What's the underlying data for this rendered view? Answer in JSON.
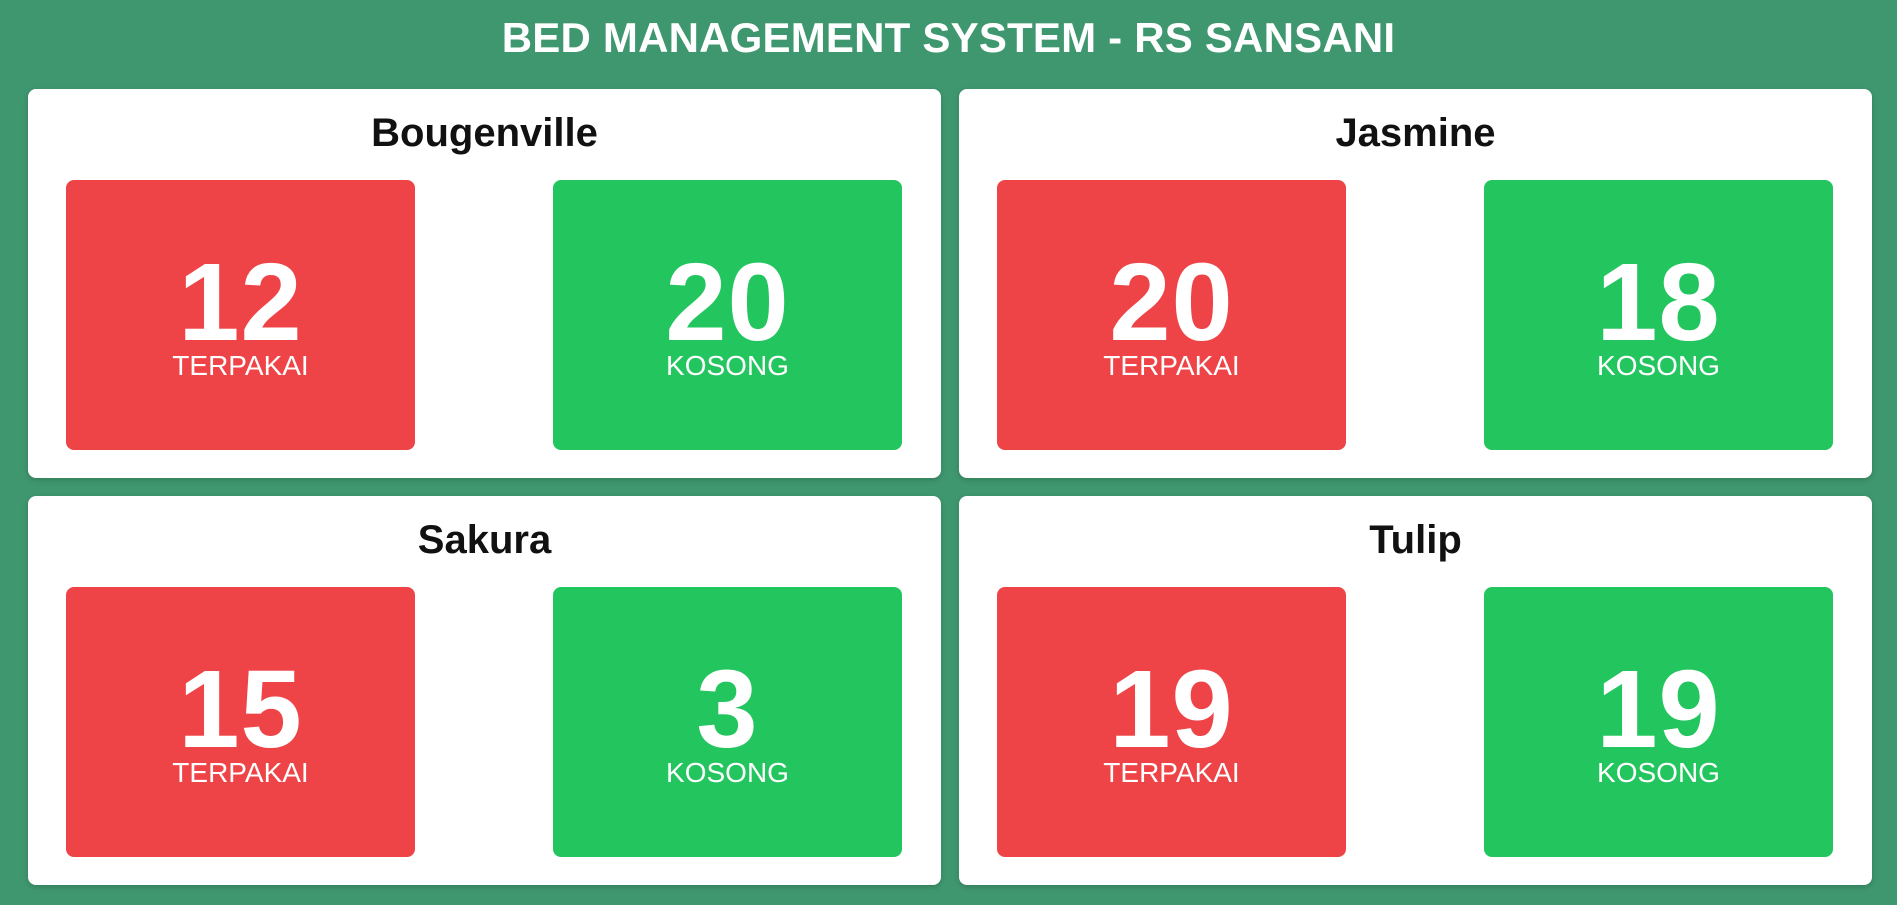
{
  "header": {
    "title": "BED MANAGEMENT SYSTEM - RS SANSANI"
  },
  "colors": {
    "background": "#3f976f",
    "occupied": "#ef4447",
    "available": "#22c55e"
  },
  "wards": [
    {
      "name": "Bougenville",
      "occupied": "12",
      "occupied_label": "TERPAKAI",
      "available": "20",
      "available_label": "KOSONG"
    },
    {
      "name": "Jasmine",
      "occupied": "20",
      "occupied_label": "TERPAKAI",
      "available": "18",
      "available_label": "KOSONG"
    },
    {
      "name": "Sakura",
      "occupied": "15",
      "occupied_label": "TERPAKAI",
      "available": "3",
      "available_label": "KOSONG"
    },
    {
      "name": "Tulip",
      "occupied": "19",
      "occupied_label": "TERPAKAI",
      "available": "19",
      "available_label": "KOSONG"
    }
  ]
}
